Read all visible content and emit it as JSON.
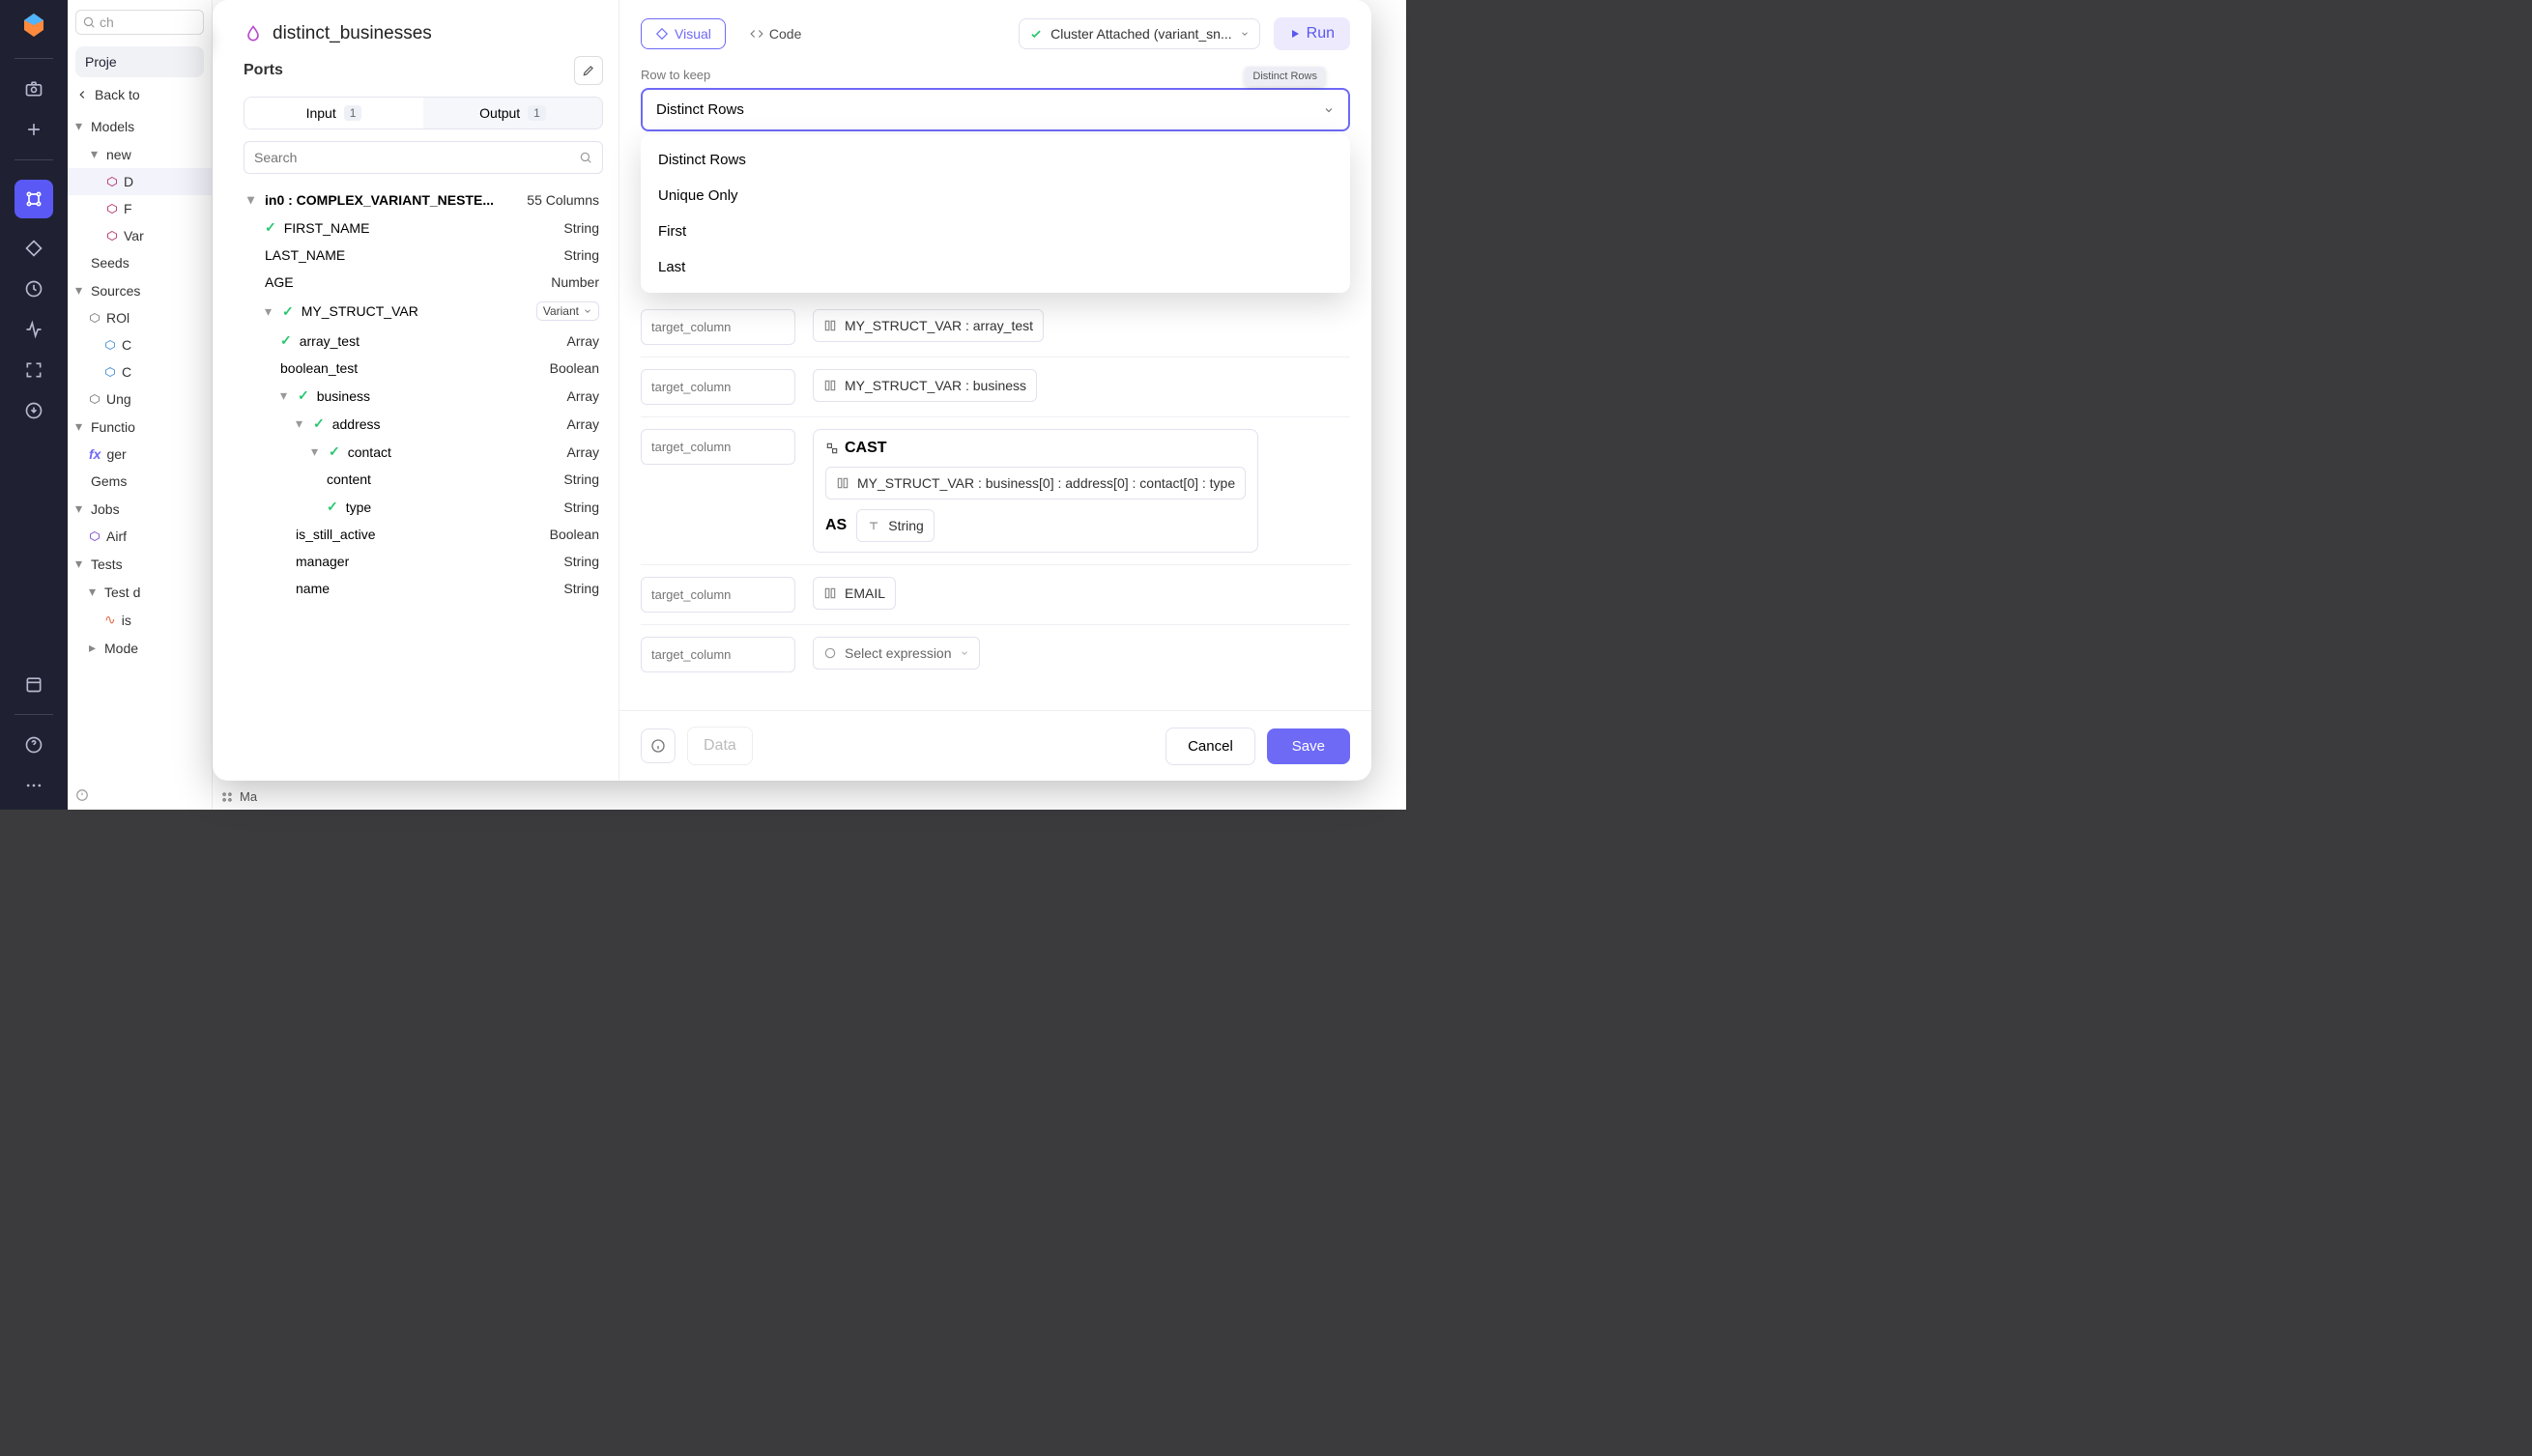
{
  "rail": {},
  "sidebar": {
    "search_placeholder": "ch",
    "project_chip": "Proje",
    "back_label": "Back to",
    "tree": {
      "models": "Models",
      "new": "new",
      "d": "D",
      "f": "F",
      "var": "Var",
      "seeds": "Seeds",
      "sources": "Sources",
      "rol": "ROl",
      "c1": "C",
      "c2": "C",
      "ung": "Ung",
      "functions": "Functio",
      "fx": "ger",
      "gems": "Gems",
      "jobs": "Jobs",
      "airf": "Airf",
      "tests": "Tests",
      "testd": "Test d",
      "is": "is",
      "model": "Mode"
    },
    "maintab": "Ma"
  },
  "modal": {
    "title": "distinct_businesses",
    "ports_label": "Ports",
    "tabs": {
      "input": "Input",
      "input_count": "1",
      "output": "Output",
      "output_count": "1"
    },
    "search_placeholder": "Search",
    "schema": {
      "head_name": "in0 : COMPLEX_VARIANT_NESTE...",
      "head_cols": "55 Columns",
      "rows": [
        {
          "name": "FIRST_NAME",
          "type": "String",
          "check": true,
          "pad": 1
        },
        {
          "name": "LAST_NAME",
          "type": "String",
          "pad": 1
        },
        {
          "name": "AGE",
          "type": "Number",
          "pad": 1
        },
        {
          "name": "MY_STRUCT_VAR",
          "type": "Variant",
          "check": true,
          "caret": true,
          "variantPill": true,
          "pad": 1
        },
        {
          "name": "array_test",
          "type": "Array",
          "check": true,
          "pad": 2
        },
        {
          "name": "boolean_test",
          "type": "Boolean",
          "pad": 2
        },
        {
          "name": "business",
          "type": "Array",
          "check": true,
          "caret": true,
          "pad": 2
        },
        {
          "name": "address",
          "type": "Array",
          "check": true,
          "caret": true,
          "pad": 3
        },
        {
          "name": "contact",
          "type": "Array",
          "check": true,
          "caret": true,
          "pad": 4
        },
        {
          "name": "content",
          "type": "String",
          "pad": 5
        },
        {
          "name": "type",
          "type": "String",
          "check": true,
          "pad": 5
        },
        {
          "name": "is_still_active",
          "type": "Boolean",
          "pad": 3
        },
        {
          "name": "manager",
          "type": "String",
          "pad": 3
        },
        {
          "name": "name",
          "type": "String",
          "pad": 3
        }
      ]
    },
    "right": {
      "visual_label": "Visual",
      "code_label": "Code",
      "cluster_label": "Cluster Attached (variant_sn...",
      "run_label": "Run",
      "rtk_label": "Row to keep",
      "rtk_value": "Distinct Rows",
      "tooltip": "Distinct Rows",
      "menu": [
        "Distinct Rows",
        "Unique Only",
        "First",
        "Last"
      ],
      "target_ph": "target_column",
      "exprs": {
        "arr": "MY_STRUCT_VAR : array_test",
        "bus": "MY_STRUCT_VAR : business",
        "cast": "CAST",
        "cast_expr": "MY_STRUCT_VAR : business[0] : address[0] : contact[0] : type",
        "as": "AS",
        "string": "String",
        "email": "EMAIL",
        "select": "Select expression"
      }
    },
    "footer": {
      "data": "Data",
      "cancel": "Cancel",
      "save": "Save"
    }
  }
}
